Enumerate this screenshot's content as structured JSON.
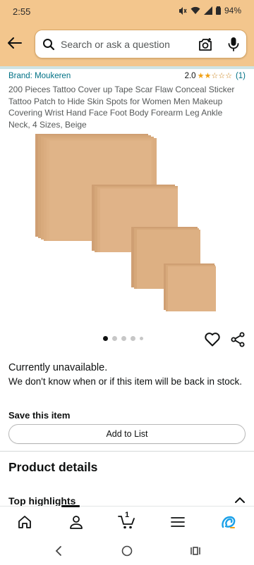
{
  "status_bar": {
    "time": "2:55",
    "battery": "94%"
  },
  "search": {
    "placeholder": "Search or ask a question"
  },
  "product": {
    "brand": "Brand: Moukeren",
    "rating_value": "2.0",
    "rating_count": "(1)",
    "stars_filled": 2,
    "stars_total": 5,
    "title": "200 Pieces Tattoo Cover up Tape Scar Flaw Conceal Sticker Tattoo Patch to Hide Skin Spots for Women Men Makeup Covering Wrist Hand Face Foot Body Forearm Leg Ankle Neck, 4 Sizes, Beige",
    "image_count": 5,
    "active_image": 1
  },
  "availability": {
    "status": "Currently unavailable.",
    "message": "We don't know when or if this item will be back in stock."
  },
  "save": {
    "title": "Save this item",
    "button_label": "Add to List"
  },
  "sections": {
    "product_details": "Product details",
    "top_highlights": "Top highlights"
  },
  "bottom_nav": {
    "items": [
      "home-icon",
      "account-icon",
      "cart-icon",
      "menu-icon",
      "rufus-icon"
    ],
    "cart_count": "1"
  },
  "colors": {
    "header_bg": "#f3c68d",
    "link": "#007185",
    "star": "#f0a014",
    "patch": "#dcae82",
    "rufus": "#1aa0e8"
  }
}
